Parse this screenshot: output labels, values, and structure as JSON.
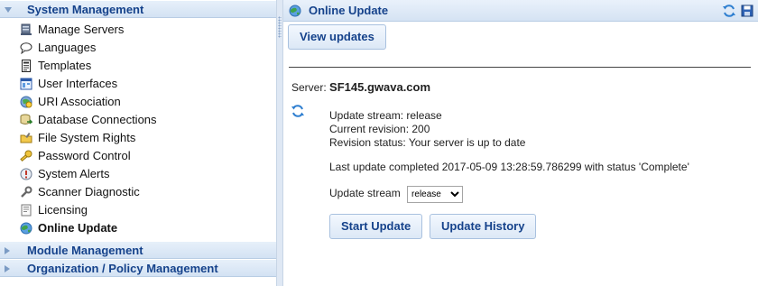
{
  "sidebar": {
    "sections": [
      {
        "label": "System Management",
        "expanded": true
      },
      {
        "label": "Module Management",
        "expanded": false
      },
      {
        "label": "Organization / Policy Management",
        "expanded": false
      }
    ],
    "items": [
      {
        "label": "Manage Servers",
        "icon": "server-icon"
      },
      {
        "label": "Languages",
        "icon": "speech-bubble-icon"
      },
      {
        "label": "Templates",
        "icon": "template-icon"
      },
      {
        "label": "User Interfaces",
        "icon": "user-interface-icon"
      },
      {
        "label": "URI Association",
        "icon": "globe-link-icon"
      },
      {
        "label": "Database Connections",
        "icon": "database-icon"
      },
      {
        "label": "File System Rights",
        "icon": "folder-key-icon"
      },
      {
        "label": "Password Control",
        "icon": "key-icon"
      },
      {
        "label": "System Alerts",
        "icon": "alert-icon"
      },
      {
        "label": "Scanner Diagnostic",
        "icon": "wrench-icon"
      },
      {
        "label": "Licensing",
        "icon": "license-icon"
      },
      {
        "label": "Online Update",
        "icon": "globe-icon",
        "active": true
      }
    ]
  },
  "panel": {
    "title": "Online Update",
    "view_updates_label": "View updates",
    "server_label": "Server:",
    "server_value": "SF145.gwava.com",
    "stream_line": "Update stream: release",
    "revision_line": "Current revision: 200",
    "status_line": "Revision status: Your server is up to date",
    "last_update_line": "Last update completed 2017-05-09 13:28:59.786299 with status 'Complete'",
    "stream_label": "Update stream",
    "stream_selected": "release",
    "start_update_label": "Start Update",
    "update_history_label": "Update History"
  },
  "colors": {
    "header_text": "#15428b",
    "header_bg": "#d5e3f3",
    "border": "#b9cde4"
  }
}
